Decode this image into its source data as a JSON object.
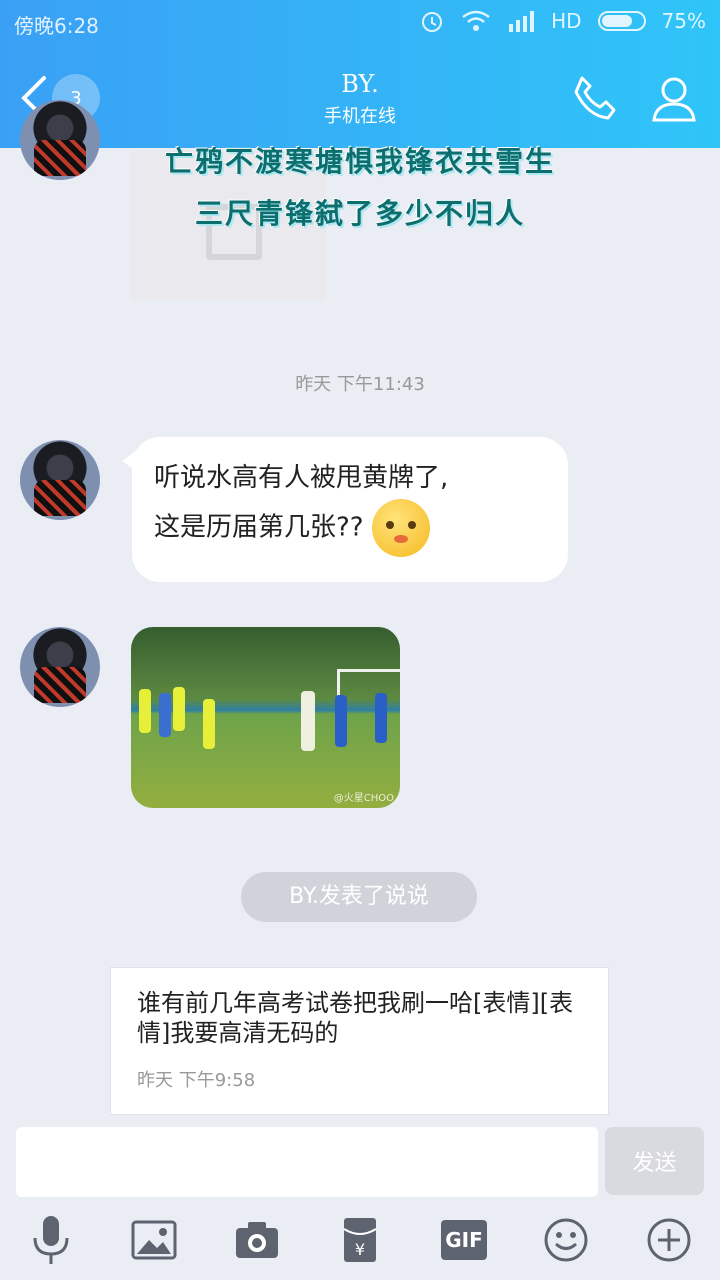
{
  "status_bar": {
    "time": "傍晚6:28",
    "network": "HD",
    "battery": "75%",
    "battery_level": 0.75
  },
  "header": {
    "unread_count": "3",
    "contact_name": "BY.",
    "contact_status": "手机在线"
  },
  "messages": {
    "poem_line1": "亡鸦不渡寒塘惧我锋衣共雪生",
    "poem_line2": "三尺青锋弑了多少不归人",
    "timestamp1": "昨天 下午11:43",
    "bubble_line1": "听说水高有人被甩黄牌了,",
    "bubble_line2": "这是历届第几张??",
    "photo_watermark": "@火星CHOO",
    "notice": "BY.发表了说说",
    "card_text": "谁有前几年高考试卷把我刷一哈[表情][表情]我要高清无码的",
    "card_time": "昨天 下午9:58"
  },
  "input": {
    "placeholder": "",
    "send_label": "发送"
  },
  "toolbar": {
    "items": [
      "microphone-icon",
      "image-icon",
      "camera-icon",
      "red-packet-icon",
      "gif-icon",
      "emoji-icon",
      "plus-icon"
    ],
    "gif_label": "GIF"
  },
  "colors": {
    "accent": "#2fb0f7",
    "background": "#ebedf4"
  }
}
